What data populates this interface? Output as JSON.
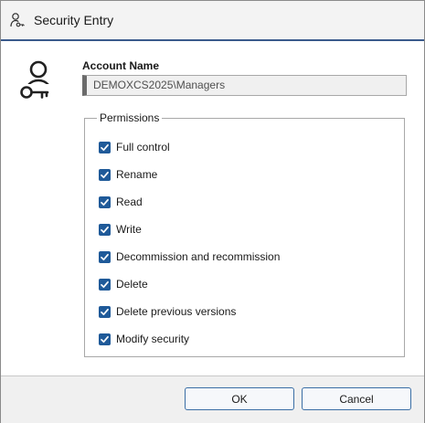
{
  "window": {
    "title": "Security Entry",
    "icon": "user-key-icon"
  },
  "account": {
    "label": "Account Name",
    "value": "DEMOXCS2025\\Managers",
    "icon": "user-key-icon"
  },
  "permissions": {
    "legend": "Permissions",
    "items": [
      {
        "label": "Full control",
        "checked": true
      },
      {
        "label": "Rename",
        "checked": true
      },
      {
        "label": "Read",
        "checked": true
      },
      {
        "label": "Write",
        "checked": true
      },
      {
        "label": "Decommission and recommission",
        "checked": true
      },
      {
        "label": "Delete",
        "checked": true
      },
      {
        "label": "Delete previous versions",
        "checked": true
      },
      {
        "label": "Modify security",
        "checked": true
      }
    ]
  },
  "buttons": {
    "ok": "OK",
    "cancel": "Cancel"
  },
  "colors": {
    "accent": "#1f5a99",
    "title_underline": "#3a5a8c",
    "button_border": "#3a6ea5"
  }
}
